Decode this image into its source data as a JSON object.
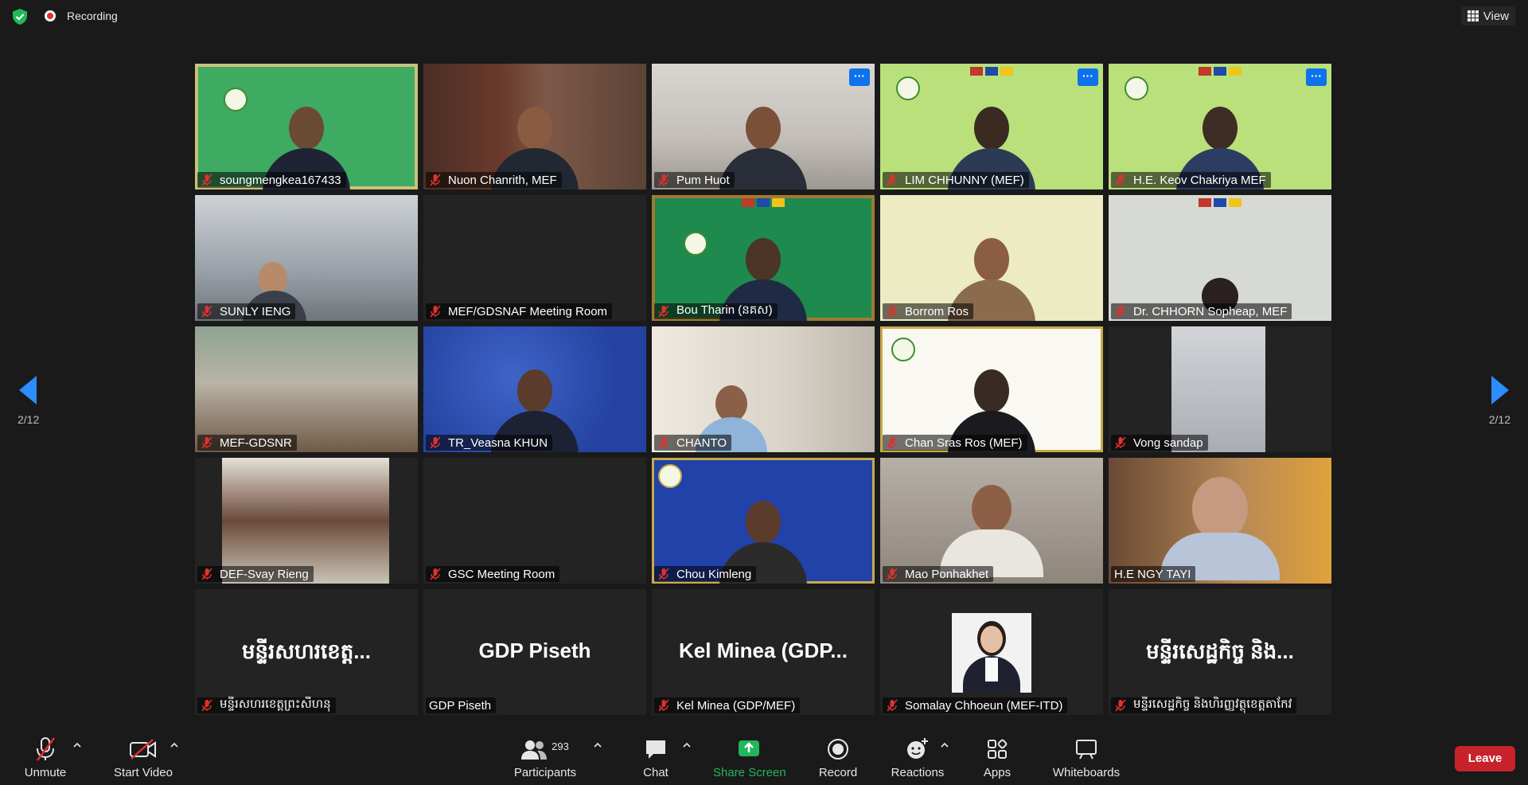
{
  "top": {
    "recording_label": "Recording",
    "view_label": "View"
  },
  "pager": {
    "left_indicator": "2/12",
    "right_indicator": "2/12"
  },
  "participants": [
    {
      "name": "soungmengkea167433",
      "muted": true
    },
    {
      "name": "Nuon Chanrith, MEF",
      "muted": true
    },
    {
      "name": "Pum Huot",
      "muted": true
    },
    {
      "name": "LIM CHHUNNY (MEF)",
      "muted": true
    },
    {
      "name": "H.E. Keov Chakriya MEF",
      "muted": true
    },
    {
      "name": "SUNLY IENG",
      "muted": true
    },
    {
      "name": "MEF/GDSNAF Meeting Room",
      "muted": true
    },
    {
      "name": "Bou Tharin (នគស)",
      "muted": true
    },
    {
      "name": "Borrom Ros",
      "muted": true
    },
    {
      "name": "Dr. CHHORN Sopheap, MEF",
      "muted": true
    },
    {
      "name": "MEF-GDSNR",
      "muted": true
    },
    {
      "name": "TR_Veasna KHUN",
      "muted": true
    },
    {
      "name": "CHANTO",
      "muted": true
    },
    {
      "name": "Chan Sras Ros (MEF)",
      "muted": true
    },
    {
      "name": "Vong sandap",
      "muted": true
    },
    {
      "name": "DEF-Svay Rieng",
      "muted": true
    },
    {
      "name": "GSC Meeting Room",
      "muted": true
    },
    {
      "name": "Chou Kimleng",
      "muted": true
    },
    {
      "name": "Mao Ponhakhet",
      "muted": true
    },
    {
      "name": "H.E NGY TAYI",
      "muted": false
    },
    {
      "name": "មន្ទីរសហរខេត្តព្រះសីហនុ",
      "muted": true,
      "display": "មន្ទីរសហរខេត្ត..."
    },
    {
      "name": "GDP Piseth",
      "muted": false,
      "display": "GDP Piseth"
    },
    {
      "name": "Kel Minea (GDP/MEF)",
      "muted": true,
      "display": "Kel Minea (GDP..."
    },
    {
      "name": "Somalay Chhoeun (MEF-ITD)",
      "muted": true
    },
    {
      "name": "មន្ទីរសេដ្ឋកិច្ច និងហិរញ្ញវត្ថុខេត្តតាកែវ",
      "muted": true,
      "display": "មន្ទីរសេដ្ឋកិច្ច និង..."
    }
  ],
  "toolbar": {
    "unmute": "Unmute",
    "start_video": "Start Video",
    "participants": "Participants",
    "participants_count": "293",
    "chat": "Chat",
    "share_screen": "Share Screen",
    "record": "Record",
    "reactions": "Reactions",
    "apps": "Apps",
    "whiteboards": "Whiteboards",
    "leave": "Leave"
  },
  "colors": {
    "accent_blue": "#0e72ed",
    "share_green": "#1fb85a",
    "leave_red": "#c8232c",
    "mute_red": "#e0312d",
    "nav_arrow": "#2d8cff"
  }
}
